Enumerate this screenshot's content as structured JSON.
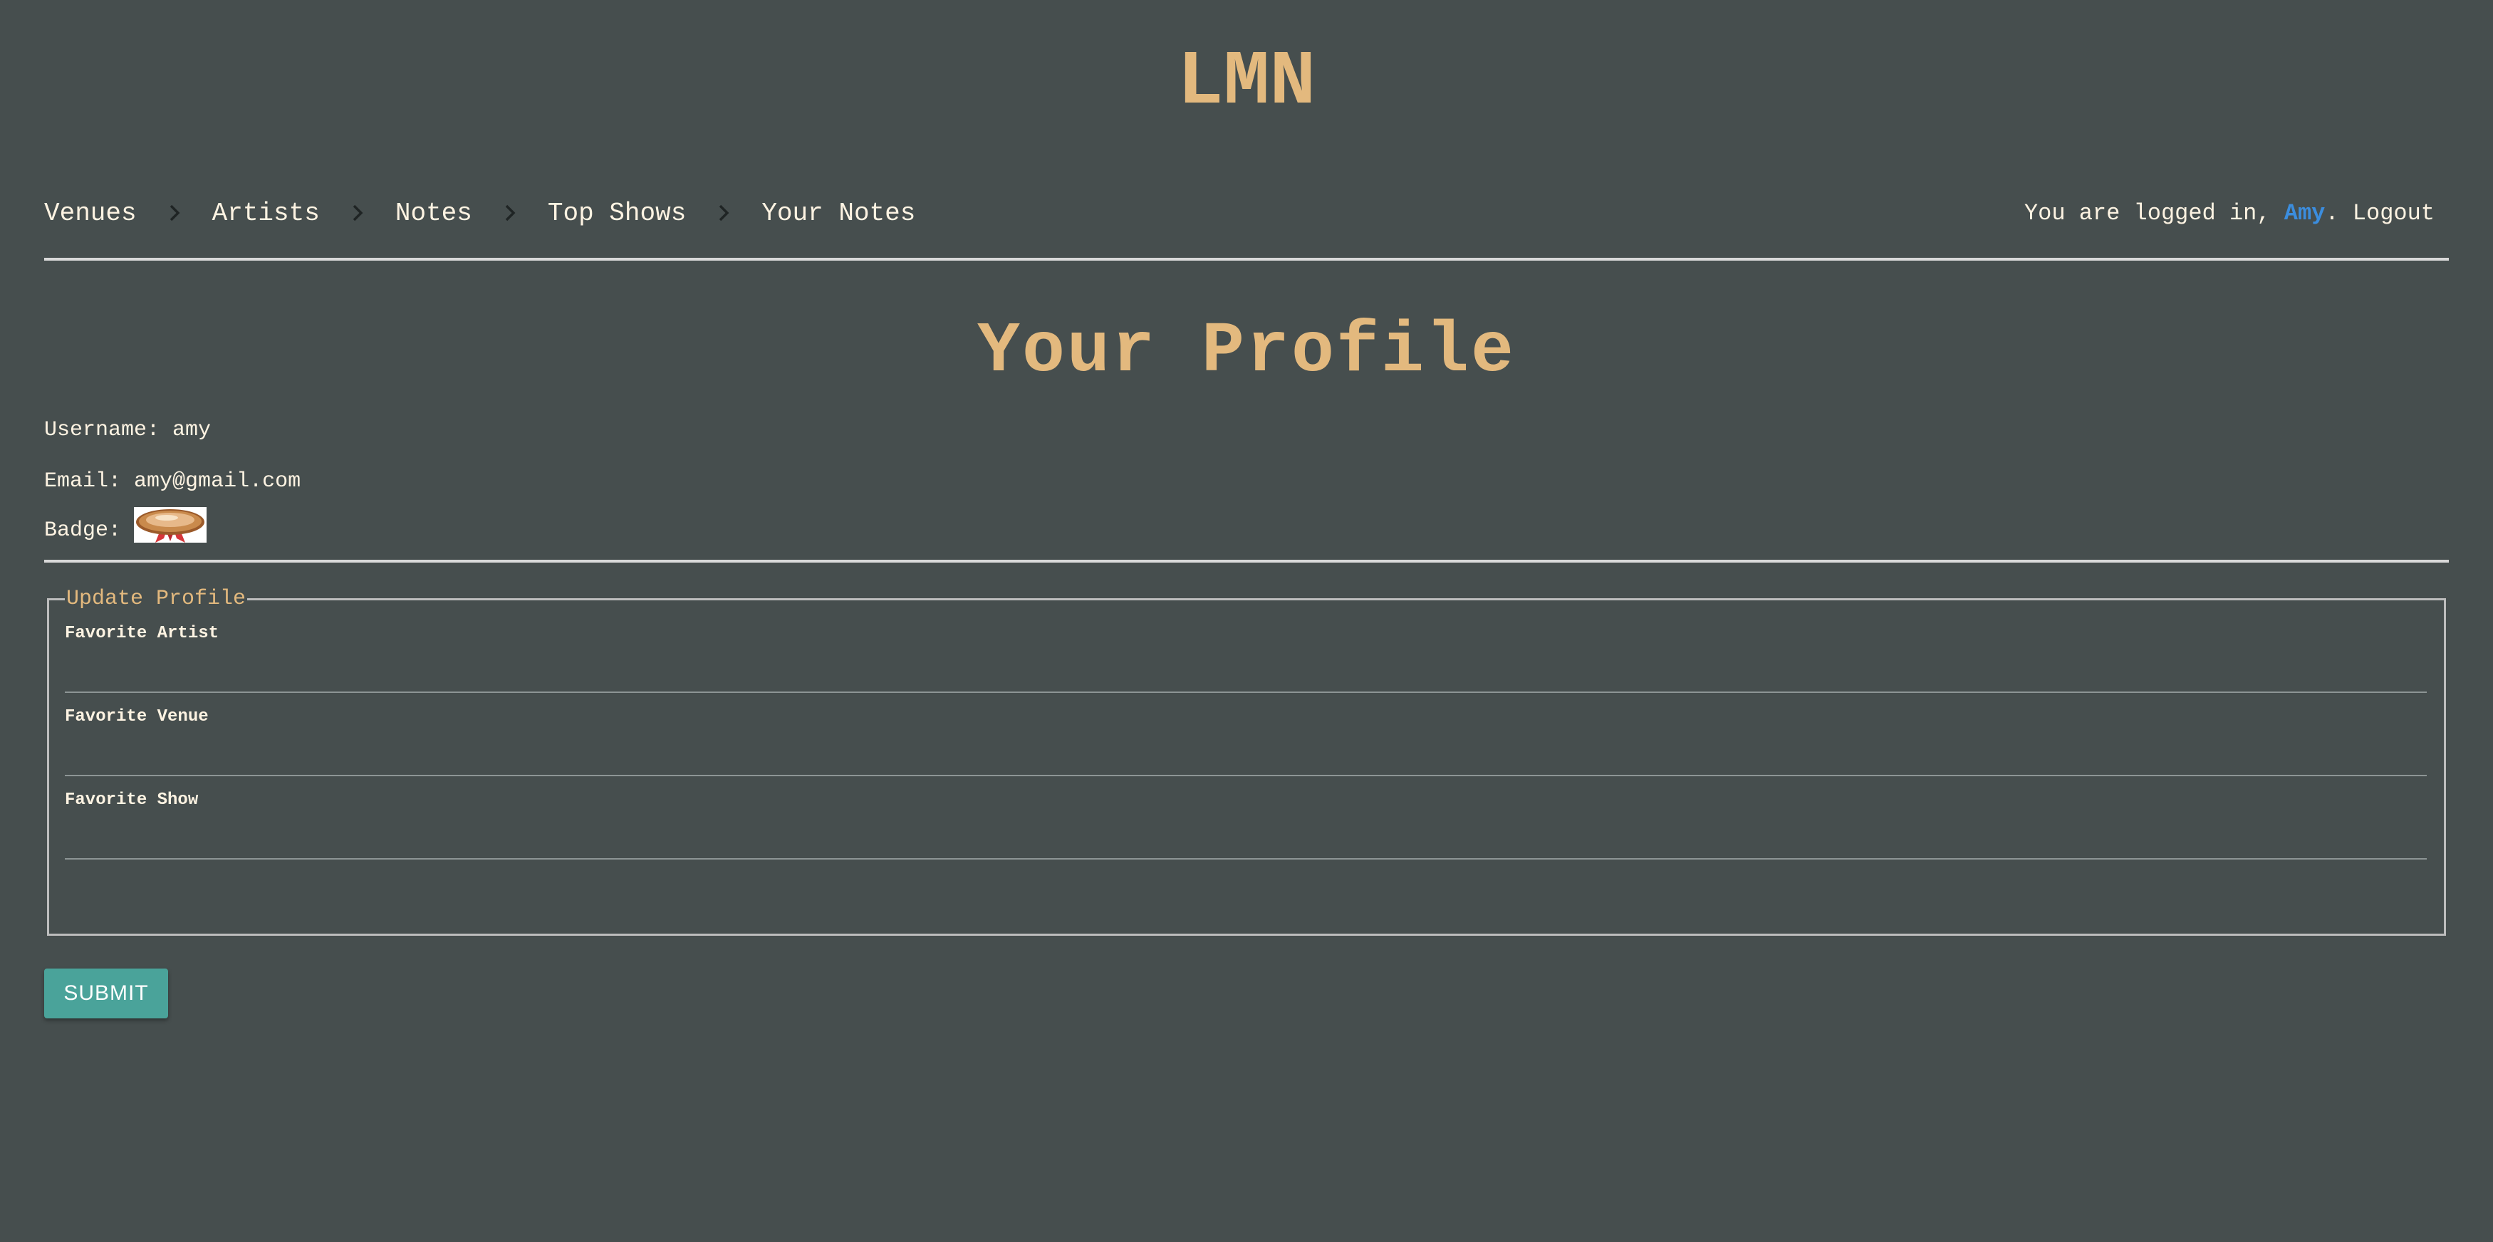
{
  "site": {
    "title": "LMN"
  },
  "nav": {
    "crumbs": [
      {
        "label": "Venues"
      },
      {
        "label": "Artists"
      },
      {
        "label": "Notes"
      },
      {
        "label": "Top Shows"
      },
      {
        "label": "Your Notes"
      }
    ],
    "separator_icon": "chevron-right-icon",
    "login": {
      "prefix": "You are logged in, ",
      "username": "Amy",
      "sep": ". ",
      "logout": "Logout"
    }
  },
  "profile": {
    "title": "Your Profile",
    "username_label": "Username:",
    "username": "amy",
    "email_label": "Email:",
    "email": "amy@gmail.com",
    "badge_label": "Badge:",
    "badge_icon": "medal-badge-icon"
  },
  "form": {
    "legend": "Update Profile",
    "fields": [
      {
        "label": "Favorite Artist",
        "value": ""
      },
      {
        "label": "Favorite Venue",
        "value": ""
      },
      {
        "label": "Favorite Show",
        "value": ""
      }
    ],
    "submit_label": "SUBMIT"
  },
  "colors": {
    "background": "#464e4e",
    "accent_gold": "#e3b97e",
    "link_blue": "#3b8dde",
    "button_teal": "#4aa39a"
  }
}
